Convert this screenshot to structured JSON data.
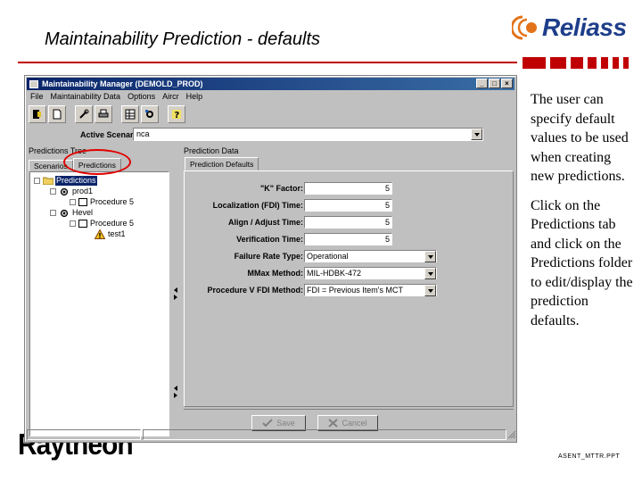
{
  "slide": {
    "title": "Maintainability Prediction - defaults",
    "logo_text": "Reliass",
    "side_paragraph_1": "The user can specify default values to be used when creating new predictions.",
    "side_paragraph_2": "Click on the Predictions tab and click on the Predictions folder to edit/display the prediction defaults.",
    "footer_logo": "Raytheon",
    "footer_id": "ASENT_MTTR.PPT",
    "accent_color": "#c00000",
    "logo_color": "#1e3e8a"
  },
  "window": {
    "title": "Maintainability Manager (DEMOLD_PROD)",
    "controls": [
      "_",
      "□",
      "×"
    ],
    "menu": [
      "File",
      "Maintainability Data",
      "Options",
      "Aircr",
      "Help"
    ],
    "toolbar_icons": [
      "exit-icon",
      "new-icon",
      "tools-icon",
      "print-icon",
      "grid-icon",
      "settings-icon",
      "help-icon"
    ],
    "active_scenario_label": "Active Scenario:",
    "active_scenario_value": "nca",
    "left_panel": {
      "title": "Predictions Tree",
      "tabs": [
        "Scenarios",
        "Predictions"
      ],
      "active_tab": "Predictions",
      "tree": [
        {
          "label": "Predictions",
          "level": 0,
          "icon": "folder-icon",
          "selected": true
        },
        {
          "label": "prod1",
          "level": 1,
          "icon": "gear-icon",
          "selected": false
        },
        {
          "label": "Procedure 5",
          "level": 2,
          "icon": "procedure-icon",
          "selected": false
        },
        {
          "label": "Hevel",
          "level": 1,
          "icon": "gear-icon",
          "selected": false
        },
        {
          "label": "Procedure 5",
          "level": 2,
          "icon": "procedure-icon",
          "selected": false
        },
        {
          "label": "test1",
          "level": 3,
          "icon": "warning-icon",
          "selected": false
        }
      ]
    },
    "right_panel": {
      "title": "Prediction Data",
      "tab": "Prediction Defaults",
      "fields": {
        "k_factor": {
          "label": "\"K\" Factor:",
          "value": "5"
        },
        "localization_time": {
          "label": "Localization (FDI) Time:",
          "value": "5"
        },
        "align_adjust_time": {
          "label": "Align / Adjust Time:",
          "value": "5"
        },
        "verification_time": {
          "label": "Verification Time:",
          "value": "5"
        },
        "failure_rate_type": {
          "label": "Failure Rate Type:",
          "value": "Operational"
        },
        "mmax_method": {
          "label": "MMax Method:",
          "value": "MIL-HDBK-472"
        },
        "procedure_v_fdi_method": {
          "label": "Procedure V FDI Method:",
          "value": "FDI = Previous Item's MCT"
        }
      },
      "save_label": "Save",
      "cancel_label": "Cancel"
    }
  }
}
